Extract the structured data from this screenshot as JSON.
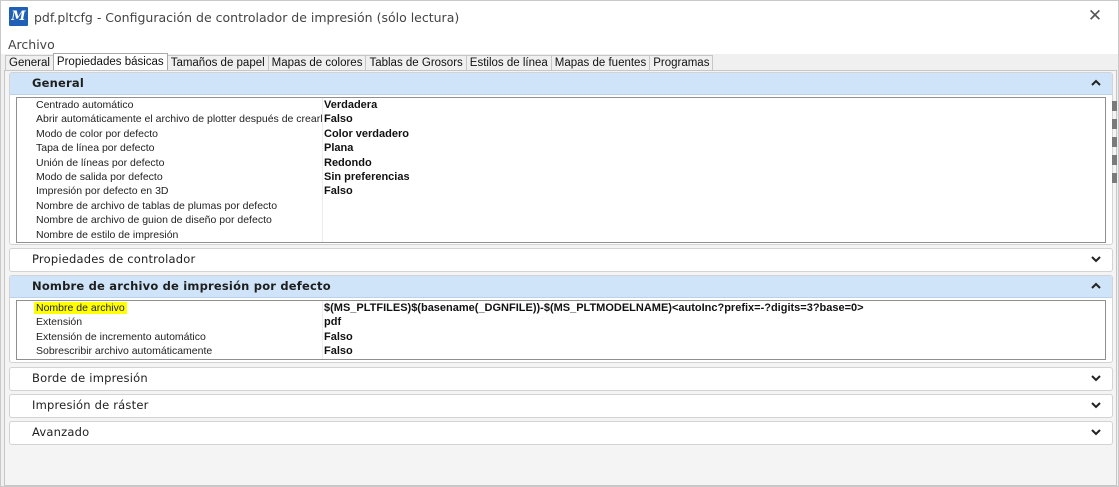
{
  "window": {
    "title": "pdf.pltcfg - Configuración de controlador de impresión (sólo lectura)",
    "app_icon_glyph": "M",
    "close_glyph": "✕"
  },
  "menu": {
    "file": "Archivo"
  },
  "tabs": [
    {
      "label": "General",
      "active": false
    },
    {
      "label": "Propiedades básicas",
      "active": true
    },
    {
      "label": "Tamaños de papel",
      "active": false
    },
    {
      "label": "Mapas de colores",
      "active": false
    },
    {
      "label": "Tablas de Grosors",
      "active": false
    },
    {
      "label": "Estilos de línea",
      "active": false
    },
    {
      "label": "Mapas de fuentes",
      "active": false
    },
    {
      "label": "Programas",
      "active": false
    }
  ],
  "sections": {
    "general": {
      "title": "General",
      "expanded": true,
      "rows": [
        {
          "name": "Centrado automático",
          "value": "Verdadera"
        },
        {
          "name": "Abrir automáticamente el archivo de plotter después de crearlo",
          "value": "Falso"
        },
        {
          "name": "Modo de color por defecto",
          "value": "Color verdadero"
        },
        {
          "name": "Tapa de línea por defecto",
          "value": "Plana"
        },
        {
          "name": "Unión de líneas por defecto",
          "value": "Redondo"
        },
        {
          "name": "Modo de salida por defecto",
          "value": "Sin preferencias"
        },
        {
          "name": "Impresión por defecto en 3D",
          "value": "Falso"
        },
        {
          "name": "Nombre de archivo de tablas de plumas por defecto",
          "value": ""
        },
        {
          "name": "Nombre de archivo de guion de diseño por defecto",
          "value": ""
        },
        {
          "name": "Nombre de estilo de impresión",
          "value": ""
        }
      ]
    },
    "driver": {
      "title": "Propiedades de controlador",
      "expanded": false
    },
    "default_filename": {
      "title": "Nombre de archivo de impresión por defecto",
      "expanded": true,
      "rows": [
        {
          "name": "Nombre de archivo",
          "value": "$(MS_PLTFILES)$(basename(_DGNFILE))-$(MS_PLTMODELNAME)<autoInc?prefix=-?digits=3?base=0>",
          "highlighted": true
        },
        {
          "name": "Extensión",
          "value": "pdf"
        },
        {
          "name": "Extensión de incremento automático",
          "value": "Falso"
        },
        {
          "name": "Sobrescribir archivo automáticamente",
          "value": "Falso"
        }
      ]
    },
    "border": {
      "title": "Borde de impresión",
      "expanded": false
    },
    "raster": {
      "title": "Impresión de ráster",
      "expanded": false
    },
    "advanced": {
      "title": "Avanzado",
      "expanded": false
    }
  },
  "colors": {
    "header_expanded": "#cfe4f8",
    "highlight": "#ffff00",
    "app_icon": "#1f5fb5"
  }
}
